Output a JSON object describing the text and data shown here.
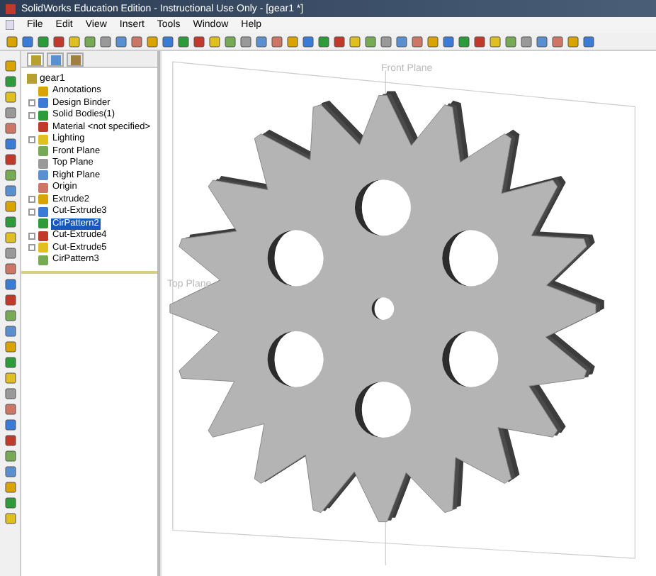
{
  "window": {
    "title": "SolidWorks Education Edition - Instructional Use Only - [gear1 *]"
  },
  "menu": [
    "File",
    "Edit",
    "View",
    "Insert",
    "Tools",
    "Window",
    "Help"
  ],
  "tree": {
    "root": "gear1",
    "items": [
      {
        "label": "Annotations",
        "collapsible": false,
        "selected": false
      },
      {
        "label": "Design Binder",
        "collapsible": true,
        "selected": false
      },
      {
        "label": "Solid Bodies(1)",
        "collapsible": true,
        "selected": false
      },
      {
        "label": "Material <not specified>",
        "collapsible": false,
        "selected": false
      },
      {
        "label": "Lighting",
        "collapsible": true,
        "selected": false
      },
      {
        "label": "Front Plane",
        "collapsible": false,
        "selected": false
      },
      {
        "label": "Top Plane",
        "collapsible": false,
        "selected": false
      },
      {
        "label": "Right Plane",
        "collapsible": false,
        "selected": false
      },
      {
        "label": "Origin",
        "collapsible": false,
        "selected": false
      },
      {
        "label": "Extrude2",
        "collapsible": true,
        "selected": false
      },
      {
        "label": "Cut-Extrude3",
        "collapsible": true,
        "selected": false
      },
      {
        "label": "CirPattern2",
        "collapsible": false,
        "selected": true
      },
      {
        "label": "Cut-Extrude4",
        "collapsible": true,
        "selected": false
      },
      {
        "label": "Cut-Extrude5",
        "collapsible": true,
        "selected": false
      },
      {
        "label": "CirPattern3",
        "collapsible": false,
        "selected": false
      }
    ]
  },
  "viewport": {
    "plane_labels": [
      "Front Plane",
      "Top Plane"
    ]
  }
}
